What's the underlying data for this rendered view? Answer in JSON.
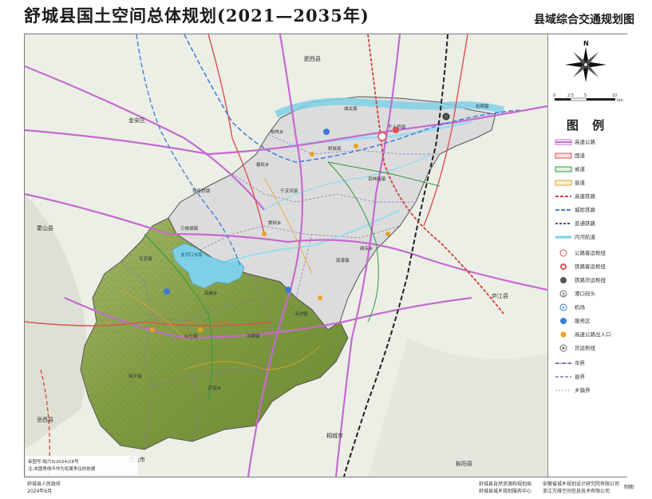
{
  "title": "舒城县国土空间总体规划(2021—2035年)",
  "subtitle": "县域综合交通规划图",
  "legend": {
    "title": "图 例",
    "items": [
      {
        "label": "高速公路",
        "icon": "highway-line"
      },
      {
        "label": "国道",
        "icon": "national-road-line"
      },
      {
        "label": "省道",
        "icon": "provincial-road-line"
      },
      {
        "label": "县道",
        "icon": "county-road-line"
      },
      {
        "label": "高速铁路",
        "icon": "high-speed-rail-line"
      },
      {
        "label": "城际铁路",
        "icon": "intercity-rail-line"
      },
      {
        "label": "普通铁路",
        "icon": "railway-line"
      },
      {
        "label": "内河航道",
        "icon": "waterway-line"
      },
      {
        "label": "公路客运枢纽",
        "icon": "bus-hub-icon"
      },
      {
        "label": "铁路客运枢纽",
        "icon": "rail-passenger-hub-icon"
      },
      {
        "label": "铁路货运枢纽",
        "icon": "rail-freight-hub-icon"
      },
      {
        "label": "港口码头",
        "icon": "port-icon"
      },
      {
        "label": "机场",
        "icon": "airport-icon"
      },
      {
        "label": "服务区",
        "icon": "service-area-icon"
      },
      {
        "label": "高速公路出入口",
        "icon": "expressway-exit-icon"
      },
      {
        "label": "货运枢纽",
        "icon": "freight-hub-icon"
      },
      {
        "label": "市界",
        "icon": "city-boundary-line"
      },
      {
        "label": "县界",
        "icon": "county-boundary-line"
      },
      {
        "label": "乡镇界",
        "icon": "township-boundary-line"
      }
    ]
  },
  "compass": {
    "north": "N",
    "scale": [
      "0",
      "2.5",
      "5",
      "10"
    ],
    "unit": "km"
  },
  "map_labels": {
    "counties": [
      "肥西县",
      "金安区",
      "霍山县",
      "庐江县",
      "桐城市",
      "岳西县",
      "潜山市",
      "枞阳县"
    ],
    "towns": [
      "杭埠镇",
      "柏林乡",
      "舒城县",
      "千人桥镇",
      "春秋乡",
      "城关镇",
      "南港镇",
      "万佛湖镇",
      "干汊河镇",
      "百神庙镇",
      "阙店乡",
      "五显镇",
      "高峰乡",
      "山七镇",
      "河棚镇",
      "汤池镇",
      "棠树乡",
      "庐镇乡",
      "晓天镇",
      "张母桥镇"
    ],
    "lake": "龙河口水库"
  },
  "notes": [
    "审图号:皖六S(2024)18号",
    "注:本图界线不作为权属争议的依据"
  ],
  "footer": {
    "left_lines": [
      "舒城县人民政府",
      "2024年6月"
    ],
    "mid_lines": [
      "舒城县自然资源和规划局",
      "舒城县城乡规划服务中心"
    ],
    "right_lines": [
      "安徽省城乡规划设计研究院有限公司",
      "浙江万维空间信息技术有限公司"
    ],
    "stamp": "制图"
  },
  "colors": {
    "mountain": "#8aa64a",
    "plain": "#dedede",
    "water": "#7fd0e6",
    "highway": "#c56ad0",
    "national_road": "#e05050",
    "railway": "#222222",
    "intercity": "#4a7fd8",
    "county_boundary": "#8a6fb0"
  }
}
